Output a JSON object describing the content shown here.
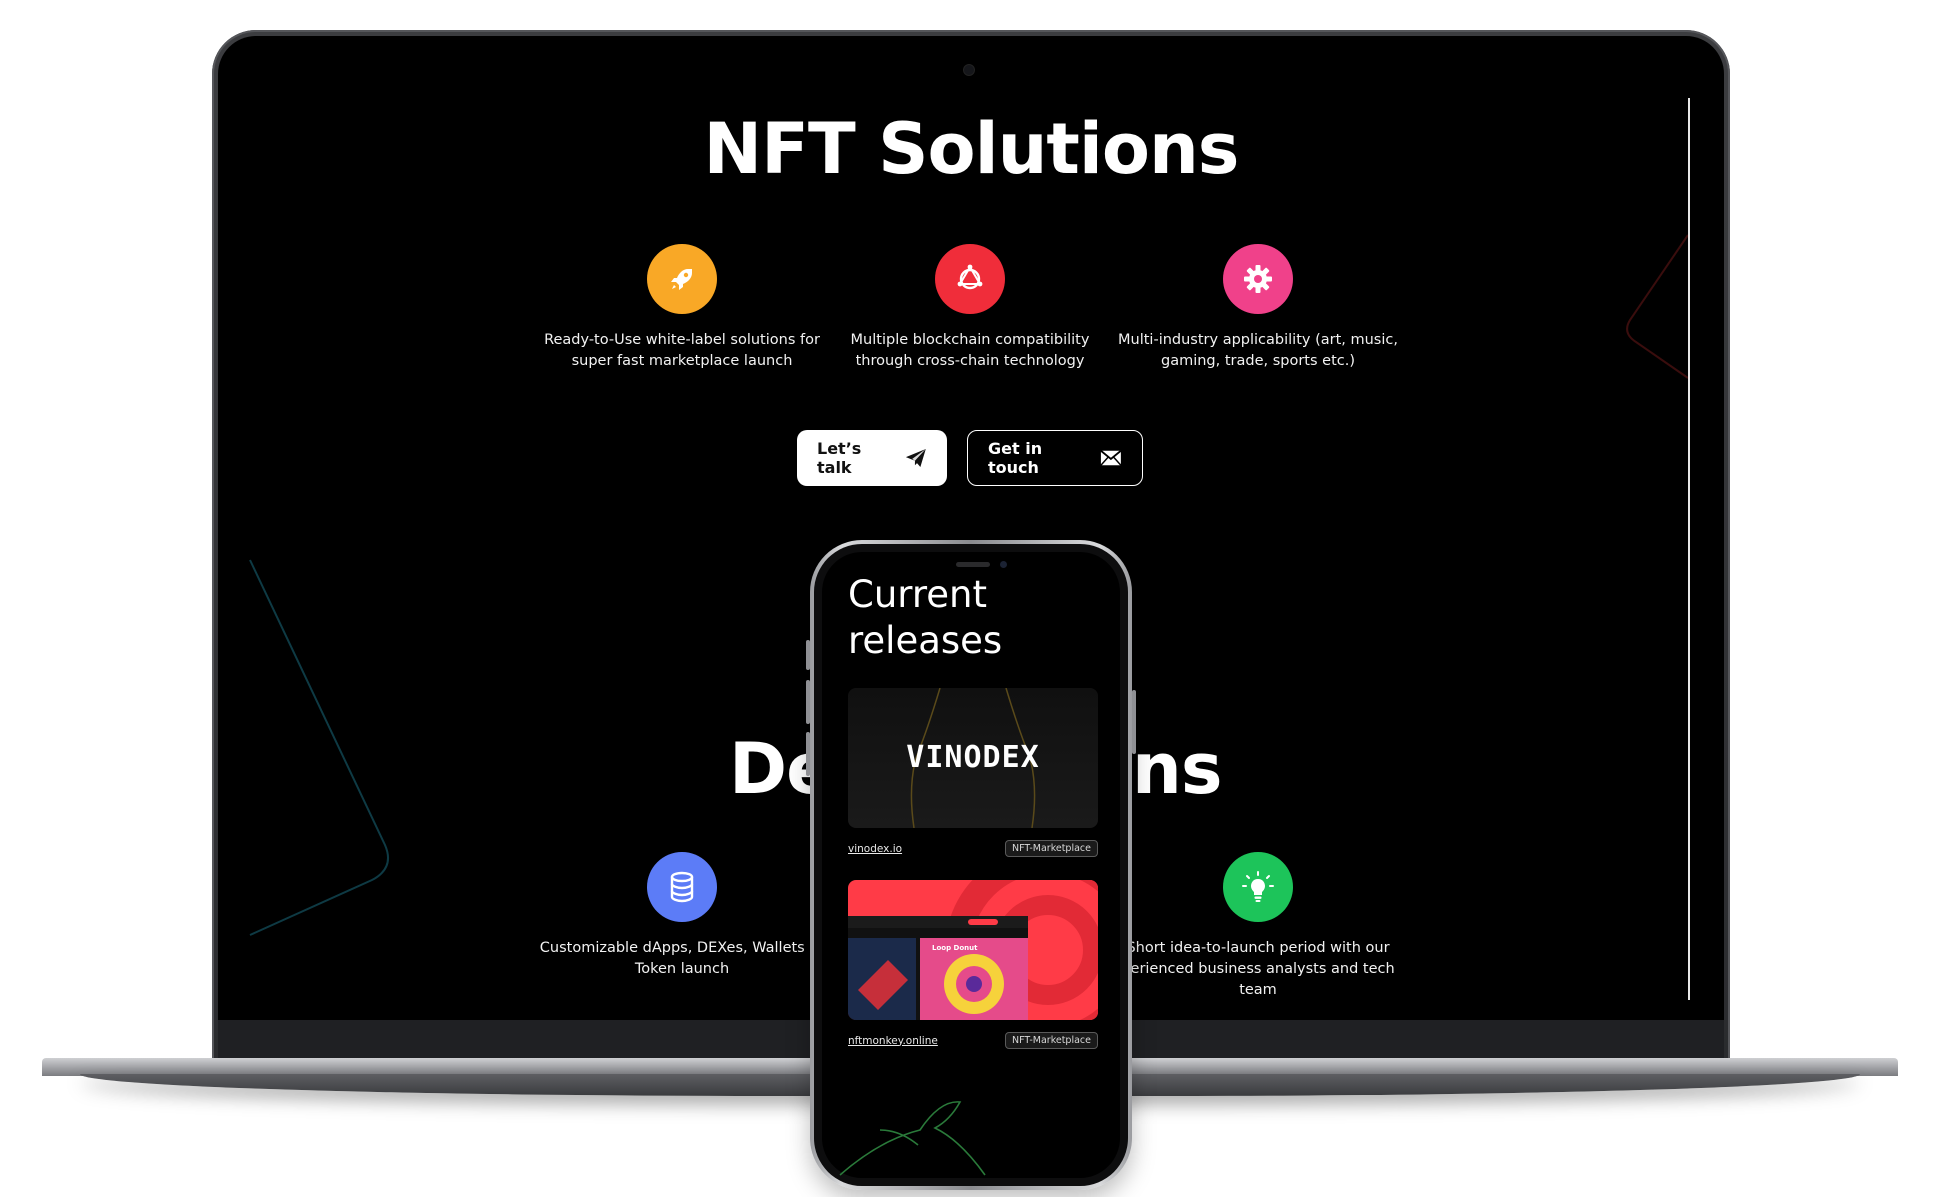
{
  "laptop_page": {
    "title": "NFT Solutions",
    "features": [
      {
        "icon": "rocket-icon",
        "color": "#f9a826",
        "text": "Ready-to-Use white-label solutions for super fast marketplace launch"
      },
      {
        "icon": "polkadot-icon",
        "color": "#f02d3a",
        "text": "Multiple blockchain compatibility through cross-chain technology"
      },
      {
        "icon": "gear-icon",
        "color": "#f0418a",
        "text": "Multi-industry applicability (art, music, gaming, trade, sports etc.)"
      }
    ],
    "buttons": {
      "lets_talk": "Let’s talk",
      "get_in_touch": "Get in touch"
    },
    "section2_title_left": "De",
    "section2_title_right": "ns",
    "features2": [
      {
        "icon": "database-icon",
        "color": "#5c7cf7",
        "text": "Customizable dApps, DEXes, Wallets ar Token launch"
      },
      {
        "icon": "lightbulb-icon",
        "color": "#1dc45a",
        "text": "Short idea-to-launch period with our perienced business analysts and tech team"
      }
    ]
  },
  "phone_page": {
    "title": "Current releases",
    "releases": [
      {
        "brand": "VINODEX",
        "link": "vinodex.io",
        "tag": "NFT-Marketplace"
      },
      {
        "brand": "Loop Donut",
        "link": "nftmonkey.online",
        "tag": "NFT-Marketplace"
      }
    ]
  },
  "colors": {
    "background": "#000000",
    "accent_orange": "#f9a826",
    "accent_red": "#f02d3a",
    "accent_pink": "#f0418a",
    "accent_blue": "#5c7cf7",
    "accent_green": "#1dc45a"
  }
}
